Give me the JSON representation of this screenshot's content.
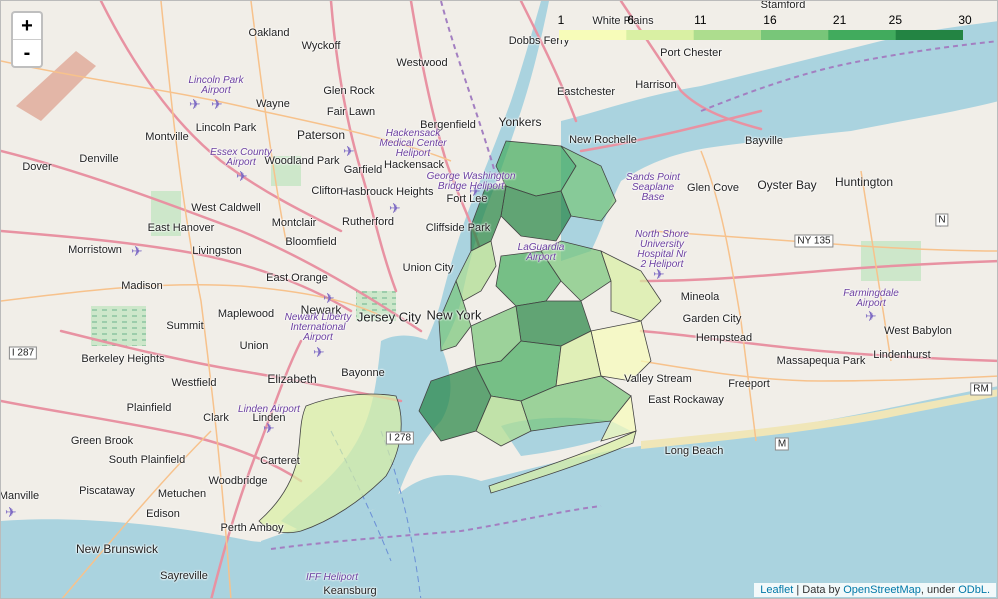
{
  "map": {
    "zoom_in_label": "+",
    "zoom_out_label": "-",
    "legend": {
      "ticks": [
        "1",
        "6",
        "11",
        "16",
        "21",
        "25",
        "30"
      ],
      "colors": [
        "#f7fcb9",
        "#d9f0a3",
        "#addd8e",
        "#78c679",
        "#41ab5d",
        "#238443"
      ]
    },
    "colors": {
      "water": "#aad3df",
      "land": "#f1eee8",
      "motorway": "#e892a2",
      "trunk": "#f9b29c",
      "boundary": "#a37fc1"
    },
    "places": [
      {
        "id": "oakland",
        "text": "Oakland",
        "size": ""
      },
      {
        "id": "wyckoff",
        "text": "Wyckoff",
        "size": ""
      },
      {
        "id": "westwood",
        "text": "Westwood",
        "size": ""
      },
      {
        "id": "dobbs-ferry",
        "text": "Dobbs Ferry",
        "size": ""
      },
      {
        "id": "white-plains",
        "text": "White Plains",
        "size": ""
      },
      {
        "id": "port-chester",
        "text": "Port Chester",
        "size": ""
      },
      {
        "id": "stamford",
        "text": "Stamford",
        "size": ""
      },
      {
        "id": "glen-rock",
        "text": "Glen Rock",
        "size": ""
      },
      {
        "id": "harrison",
        "text": "Harrison",
        "size": ""
      },
      {
        "id": "wayne",
        "text": "Wayne",
        "size": ""
      },
      {
        "id": "fair-lawn",
        "text": "Fair Lawn",
        "size": ""
      },
      {
        "id": "eastchester",
        "text": "Eastchester",
        "size": ""
      },
      {
        "id": "yonkers",
        "text": "Yonkers",
        "size": "large"
      },
      {
        "id": "lincoln-park",
        "text": "Lincoln Park",
        "size": ""
      },
      {
        "id": "montville",
        "text": "Montville",
        "size": ""
      },
      {
        "id": "paterson",
        "text": "Paterson",
        "size": "large"
      },
      {
        "id": "bergenfield",
        "text": "Bergenfield",
        "size": ""
      },
      {
        "id": "new-rochelle",
        "text": "New Rochelle",
        "size": ""
      },
      {
        "id": "bayville",
        "text": "Bayville",
        "size": ""
      },
      {
        "id": "dover",
        "text": "Dover",
        "size": ""
      },
      {
        "id": "denville",
        "text": "Denville",
        "size": ""
      },
      {
        "id": "woodland-park",
        "text": "Woodland Park",
        "size": ""
      },
      {
        "id": "hackensack",
        "text": "Hackensack",
        "size": ""
      },
      {
        "id": "garfield",
        "text": "Garfield",
        "size": ""
      },
      {
        "id": "hasbrouck-heights",
        "text": "Hasbrouck Heights",
        "size": ""
      },
      {
        "id": "clifton",
        "text": "Clifton",
        "size": ""
      },
      {
        "id": "fort-lee",
        "text": "Fort Lee",
        "size": ""
      },
      {
        "id": "glen-cove",
        "text": "Glen Cove",
        "size": ""
      },
      {
        "id": "oyster-bay",
        "text": "Oyster Bay",
        "size": "large"
      },
      {
        "id": "huntington",
        "text": "Huntington",
        "size": "large"
      },
      {
        "id": "west-caldwell",
        "text": "West Caldwell",
        "size": ""
      },
      {
        "id": "montclair",
        "text": "Montclair",
        "size": ""
      },
      {
        "id": "rutherford",
        "text": "Rutherford",
        "size": ""
      },
      {
        "id": "cliffside-park",
        "text": "Cliffside Park",
        "size": ""
      },
      {
        "id": "east-hanover",
        "text": "East Hanover",
        "size": ""
      },
      {
        "id": "bloomfield",
        "text": "Bloomfield",
        "size": ""
      },
      {
        "id": "morristown",
        "text": "Morristown",
        "size": ""
      },
      {
        "id": "livingston",
        "text": "Livingston",
        "size": ""
      },
      {
        "id": "union-city",
        "text": "Union City",
        "size": ""
      },
      {
        "id": "east-orange",
        "text": "East Orange",
        "size": ""
      },
      {
        "id": "madison",
        "text": "Madison",
        "size": ""
      },
      {
        "id": "mineola",
        "text": "Mineola",
        "size": ""
      },
      {
        "id": "newark",
        "text": "Newark",
        "size": "large"
      },
      {
        "id": "maplewood",
        "text": "Maplewood",
        "size": ""
      },
      {
        "id": "jersey-city",
        "text": "Jersey City",
        "size": "xl"
      },
      {
        "id": "new-york",
        "text": "New York",
        "size": "xl"
      },
      {
        "id": "summit",
        "text": "Summit",
        "size": ""
      },
      {
        "id": "garden-city",
        "text": "Garden City",
        "size": ""
      },
      {
        "id": "west-babylon",
        "text": "West Babylon",
        "size": ""
      },
      {
        "id": "hempstead",
        "text": "Hempstead",
        "size": ""
      },
      {
        "id": "union",
        "text": "Union",
        "size": ""
      },
      {
        "id": "berkeley-heights",
        "text": "Berkeley Heights",
        "size": ""
      },
      {
        "id": "massapequa-park",
        "text": "Massapequa Park",
        "size": ""
      },
      {
        "id": "lindenhurst",
        "text": "Lindenhurst",
        "size": ""
      },
      {
        "id": "bayonne",
        "text": "Bayonne",
        "size": ""
      },
      {
        "id": "elizabeth",
        "text": "Elizabeth",
        "size": "large"
      },
      {
        "id": "westfield",
        "text": "Westfield",
        "size": ""
      },
      {
        "id": "valley-stream",
        "text": "Valley Stream",
        "size": ""
      },
      {
        "id": "freeport",
        "text": "Freeport",
        "size": ""
      },
      {
        "id": "east-rockaway",
        "text": "East Rockaway",
        "size": ""
      },
      {
        "id": "plainfield",
        "text": "Plainfield",
        "size": ""
      },
      {
        "id": "clark",
        "text": "Clark",
        "size": ""
      },
      {
        "id": "linden",
        "text": "Linden",
        "size": ""
      },
      {
        "id": "green-brook",
        "text": "Green Brook",
        "size": ""
      },
      {
        "id": "long-beach",
        "text": "Long Beach",
        "size": ""
      },
      {
        "id": "south-plainfield",
        "text": "South Plainfield",
        "size": ""
      },
      {
        "id": "carteret",
        "text": "Carteret",
        "size": ""
      },
      {
        "id": "woodbridge",
        "text": "Woodbridge",
        "size": ""
      },
      {
        "id": "manville",
        "text": "Manville",
        "size": ""
      },
      {
        "id": "piscataway",
        "text": "Piscataway",
        "size": ""
      },
      {
        "id": "metuchen",
        "text": "Metuchen",
        "size": ""
      },
      {
        "id": "edison",
        "text": "Edison",
        "size": ""
      },
      {
        "id": "perth-amboy",
        "text": "Perth Amboy",
        "size": ""
      },
      {
        "id": "new-brunswick",
        "text": "New Brunswick",
        "size": "large"
      },
      {
        "id": "sayreville",
        "text": "Sayreville",
        "size": ""
      },
      {
        "id": "keansburg",
        "text": "Keansburg",
        "size": ""
      }
    ],
    "pois": [
      {
        "id": "lincoln-park-airport",
        "lines": [
          "Lincoln Park",
          "Airport"
        ]
      },
      {
        "id": "hackensack-medical",
        "lines": [
          "Hackensack",
          "Medical Center",
          "Heliport"
        ]
      },
      {
        "id": "essex-county-airport",
        "lines": [
          "Essex County",
          "Airport"
        ]
      },
      {
        "id": "gw-bridge-heliport",
        "lines": [
          "George Washington",
          "Bridge Heliport"
        ]
      },
      {
        "id": "sands-point",
        "lines": [
          "Sands Point",
          "Seaplane",
          "Base"
        ]
      },
      {
        "id": "north-shore-heliport",
        "lines": [
          "North Shore",
          "University",
          "Hospital Nr",
          "2 Heliport"
        ]
      },
      {
        "id": "laguardia",
        "lines": [
          "LaGuardia",
          "Airport"
        ]
      },
      {
        "id": "farmingdale-airport",
        "lines": [
          "Farmingdale",
          "Airport"
        ]
      },
      {
        "id": "newark-airport",
        "lines": [
          "Newark Liberty",
          "International",
          "Airport"
        ]
      },
      {
        "id": "linden-airport",
        "lines": [
          "Linden Airport"
        ]
      },
      {
        "id": "iff-heliport",
        "lines": [
          "IFF Heliport"
        ]
      }
    ],
    "shields": [
      {
        "id": "i287",
        "text": "I 287"
      },
      {
        "id": "ny135",
        "text": "NY 135"
      },
      {
        "id": "n-shield",
        "text": "N"
      },
      {
        "id": "rm-shield",
        "text": "RM"
      },
      {
        "id": "m-shield",
        "text": "M"
      },
      {
        "id": "i278",
        "text": "I 278"
      }
    ],
    "attribution": {
      "leaflet": "Leaflet",
      "sep1": " | Data by ",
      "osm": "OpenStreetMap",
      "sep2": ", under ",
      "odbl": "ODbL."
    }
  }
}
